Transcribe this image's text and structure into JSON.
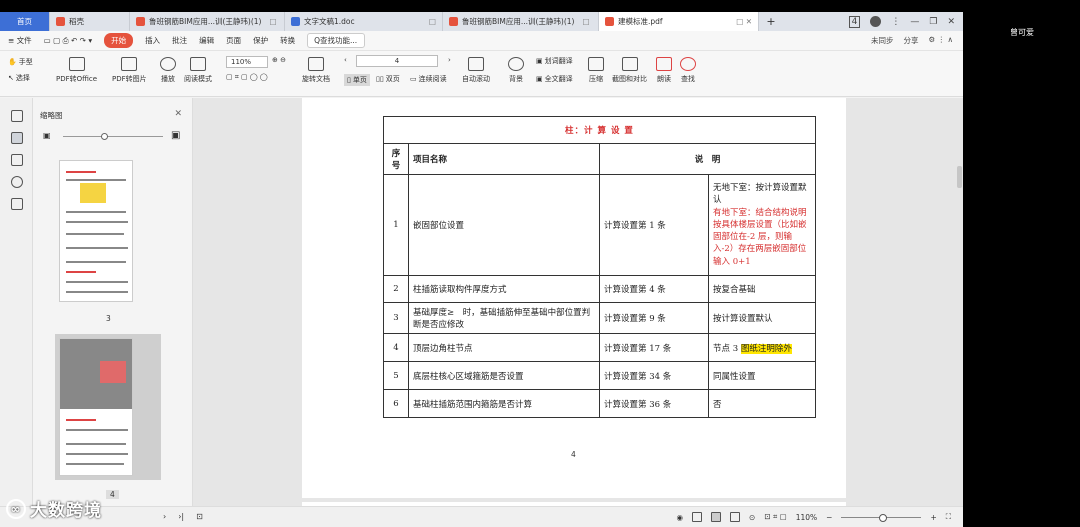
{
  "tabs": [
    {
      "label": "首页",
      "kind": "home"
    },
    {
      "label": "稻壳",
      "kind": "normal",
      "icon_color": "#e5533d"
    },
    {
      "label": "鲁班钢筋BIM应用...训(王静玮)(1)",
      "kind": "normal",
      "icon_color": "#e5533d",
      "closable": true
    },
    {
      "label": "文字文稿1.doc",
      "kind": "normal",
      "icon_color": "#3d6fd6",
      "closable": true
    },
    {
      "label": "鲁班钢筋BIM应用...训(王静玮)(1)",
      "kind": "normal",
      "icon_color": "#e5533d",
      "closable": true
    },
    {
      "label": "建模标准.pdf",
      "kind": "active",
      "icon_color": "#e5533d",
      "closable": true
    }
  ],
  "window_controls": {
    "badge": "4"
  },
  "menubar": {
    "items": [
      "≡ 文件",
      "插入",
      "批注",
      "编辑",
      "页面",
      "保护",
      "转换"
    ],
    "active": "开始",
    "search": "Q查找功能...",
    "right": [
      "未同步",
      "分享"
    ]
  },
  "toolbar": {
    "hand": "手型",
    "select": "选择",
    "pdf_to_office": "PDF转Office",
    "pdf_to_image": "PDF转图片",
    "play": "播放",
    "read_mode": "阅读模式",
    "zoom": "110%",
    "rotate": "旋转文档",
    "single": "单页",
    "double": "双页",
    "continuous": "连续阅读",
    "page_input": "4",
    "auto_scroll": "自动滚动",
    "background": "背景",
    "translate": "划词翻译",
    "full_translate": "全文翻译",
    "compress": "压缩",
    "screenshot_compare": "截图和对比",
    "read_aloud": "朗读",
    "find": "查找"
  },
  "thumb_panel": {
    "title": "缩略图",
    "pages": [
      {
        "number": "3"
      },
      {
        "number": "4"
      }
    ]
  },
  "document": {
    "table_title": "柱：计 算 设 置",
    "headers": {
      "no": "序号",
      "name": "项目名称",
      "desc": "说　明"
    },
    "rows": [
      {
        "no": "1",
        "name": "嵌固部位设置",
        "setting": "计算设置第 1 条",
        "note_black": "无地下室：按计算设置默认",
        "note_red": "有地下室：结合结构说明按具体楼层设置（比如嵌固部位在-2 层，则输入-2）存在两层嵌固部位输入 0+1"
      },
      {
        "no": "2",
        "name": "柱插筋读取构件厚度方式",
        "setting": "计算设置第 4 条",
        "note": "按复合基础"
      },
      {
        "no": "3",
        "name": "基础厚度≥　时，基础插筋伸至基础中部位置判断是否应修改",
        "setting": "计算设置第 9 条",
        "note": "按计算设置默认"
      },
      {
        "no": "4",
        "name": "顶层边角柱节点",
        "setting": "计算设置第 17 条",
        "note": "节点 3 ",
        "note_hl": "图纸注明除外"
      },
      {
        "no": "5",
        "name": "底层柱核心区域箍筋是否设置",
        "setting": "计算设置第 34 条",
        "note": "同属性设置"
      },
      {
        "no": "6",
        "name": "基础柱插筋范围内箍筋是否计算",
        "setting": "计算设置第 36 条",
        "note": "否"
      }
    ],
    "page_number": "4"
  },
  "statusbar": {
    "zoom": "110%",
    "watermark": "大数跨境"
  },
  "participant": {
    "name": "曾可爱"
  }
}
